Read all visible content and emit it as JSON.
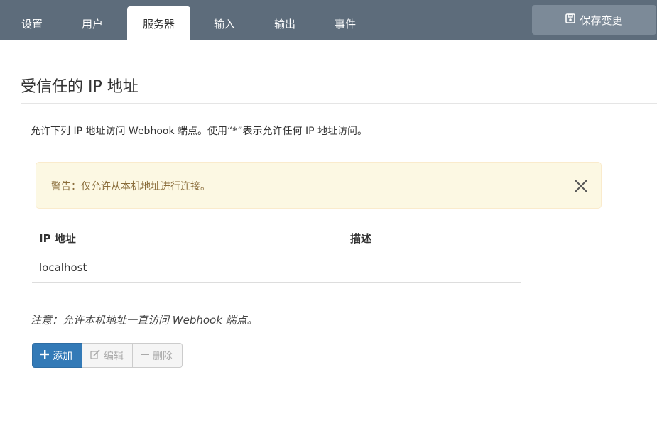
{
  "tabs": [
    {
      "label": "设置",
      "active": false
    },
    {
      "label": "用户",
      "active": false
    },
    {
      "label": "服务器",
      "active": true
    },
    {
      "label": "输入",
      "active": false
    },
    {
      "label": "输出",
      "active": false
    },
    {
      "label": "事件",
      "active": false
    }
  ],
  "toolbar": {
    "save_label": "保存变更",
    "save_icon": "floppy-disk-icon"
  },
  "section": {
    "title": "受信任的 IP 地址",
    "description": "允许下列 IP 地址访问 Webhook 端点。使用“*”表示允许任何 IP 地址访问。"
  },
  "alert": {
    "text": "警告：仅允许从本机地址进行连接。",
    "close_icon": "close-icon",
    "color": "#8a6d3b",
    "background": "#fcf8e3"
  },
  "table": {
    "headers": [
      "IP 地址",
      "描述"
    ],
    "rows": [
      [
        "localhost",
        ""
      ]
    ]
  },
  "note": "注意：允许本机地址一直访问 Webhook 端点。",
  "actions": {
    "add_label": "添加",
    "edit_label": "编辑",
    "delete_label": "删除"
  },
  "colors": {
    "topbar": "#5d6c7b",
    "primary": "#337ab7",
    "save_button": "#7c8a98"
  }
}
